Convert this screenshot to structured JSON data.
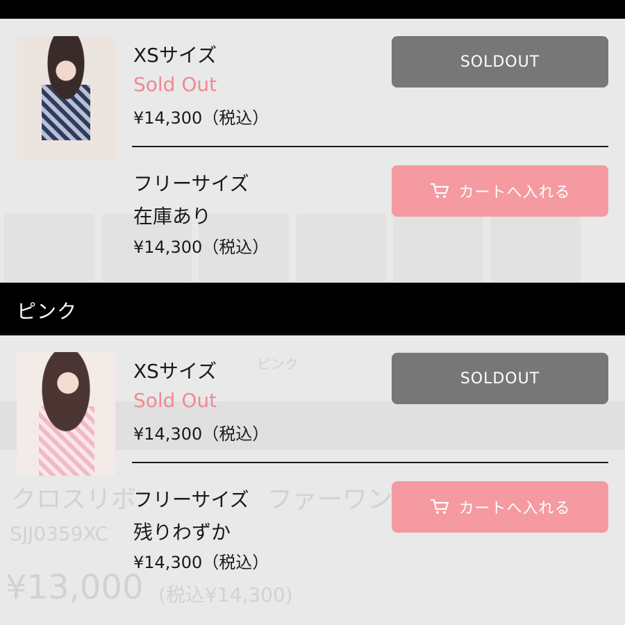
{
  "sections": [
    {
      "color_label": "",
      "sizes": [
        {
          "size": "XSサイズ",
          "status": "Sold Out",
          "price": "¥14,300（税込）",
          "button": "SOLDOUT"
        },
        {
          "size": "フリーサイズ",
          "status": "在庫あり",
          "price": "¥14,300（税込）",
          "button": "カートへ入れる"
        }
      ]
    },
    {
      "color_label": "ピンク",
      "sizes": [
        {
          "size": "XSサイズ",
          "status": "Sold Out",
          "price": "¥14,300（税込）",
          "button": "SOLDOUT"
        },
        {
          "size": "フリーサイズ",
          "status": "残りわずか",
          "price": "¥14,300（税込）",
          "button": "カートへ入れる"
        }
      ]
    }
  ],
  "background": {
    "product_name_fragment": "クロスリボ",
    "product_name_fragment2": "ファーワン",
    "sku": "SJJ0359XC",
    "price": "¥13,000",
    "price_tax": "(税込¥14,300)",
    "tab_fragment": "ピンク"
  },
  "colors": {
    "soldout_button": "#777777",
    "cart_button": "#f49aa0",
    "soldout_text": "#f08a90",
    "header_bar": "#000000"
  },
  "icons": {
    "cart": "cart-icon"
  }
}
